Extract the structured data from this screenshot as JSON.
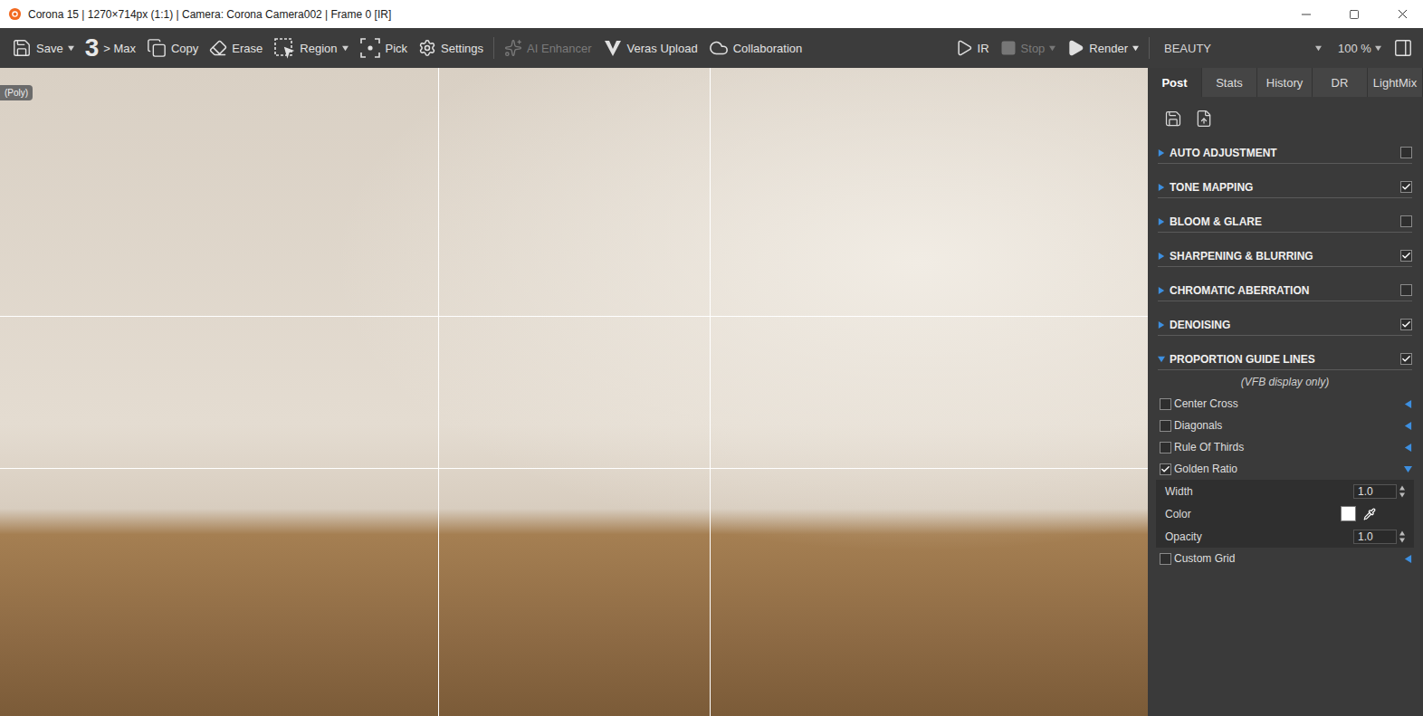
{
  "window": {
    "title": "Corona 15 | 1270×714px (1:1) | Camera: Corona Camera002 | Frame 0 [IR]"
  },
  "toolbar": {
    "left": [
      {
        "kind": "button",
        "label": "Save",
        "dropdown": true,
        "disabled": false
      },
      {
        "kind": "counter",
        "label": "3",
        "suffix": "> Max",
        "dropdown": false,
        "disabled": false
      },
      {
        "kind": "button",
        "label": "Copy",
        "dropdown": false,
        "disabled": false
      },
      {
        "kind": "button",
        "label": "Erase",
        "dropdown": false,
        "disabled": false
      },
      {
        "kind": "button",
        "label": "Region",
        "dropdown": true,
        "disabled": false
      },
      {
        "kind": "button",
        "label": "Pick",
        "dropdown": false,
        "disabled": false
      },
      {
        "kind": "button",
        "label": "Settings",
        "dropdown": false,
        "disabled": false
      },
      {
        "kind": "separator",
        "label": "",
        "dropdown": false,
        "disabled": false
      },
      {
        "kind": "button",
        "label": "AI Enhancer",
        "dropdown": false,
        "disabled": true
      },
      {
        "kind": "button",
        "label": "Veras Upload",
        "dropdown": false,
        "disabled": false
      },
      {
        "kind": "button",
        "label": "Collaboration",
        "dropdown": false,
        "disabled": false
      }
    ],
    "right": [
      {
        "label": "IR",
        "dropdown": false,
        "disabled": false
      },
      {
        "label": "Stop",
        "dropdown": true,
        "disabled": true
      },
      {
        "label": "Render",
        "dropdown": true,
        "disabled": false
      }
    ],
    "channel": "BEAUTY",
    "zoom": "100 %"
  },
  "viewport": {
    "badge": "(Poly)"
  },
  "panel": {
    "tabs": [
      {
        "label": "Post",
        "selected": true
      },
      {
        "label": "Stats",
        "selected": false
      },
      {
        "label": "History",
        "selected": false
      },
      {
        "label": "DR",
        "selected": false
      },
      {
        "label": "LightMix",
        "selected": false
      }
    ],
    "sections": [
      {
        "title": "AUTO ADJUSTMENT",
        "enabled": false,
        "expanded": false
      },
      {
        "title": "TONE MAPPING",
        "enabled": true,
        "expanded": false
      },
      {
        "title": "BLOOM & GLARE",
        "enabled": false,
        "expanded": false
      },
      {
        "title": "SHARPENING & BLURRING",
        "enabled": true,
        "expanded": false
      },
      {
        "title": "CHROMATIC ABERRATION",
        "enabled": false,
        "expanded": false
      },
      {
        "title": "DENOISING",
        "enabled": true,
        "expanded": false
      },
      {
        "title": "PROPORTION GUIDE LINES",
        "enabled": true,
        "expanded": true
      }
    ],
    "guides": {
      "note": "(VFB display only)",
      "options": [
        {
          "label": "Center Cross",
          "checked": false,
          "expanded": false,
          "fields": []
        },
        {
          "label": "Diagonals",
          "checked": false,
          "expanded": false,
          "fields": []
        },
        {
          "label": "Rule Of Thirds",
          "checked": false,
          "expanded": false,
          "fields": []
        },
        {
          "label": "Golden Ratio",
          "checked": true,
          "expanded": true,
          "fields": [
            {
              "kind": "number",
              "label": "Width",
              "value": "1.0"
            },
            {
              "kind": "color",
              "label": "Color",
              "color": "#ffffff"
            },
            {
              "kind": "number",
              "label": "Opacity",
              "value": "1.0"
            }
          ]
        },
        {
          "label": "Custom Grid",
          "checked": false,
          "expanded": false,
          "fields": []
        }
      ]
    }
  }
}
